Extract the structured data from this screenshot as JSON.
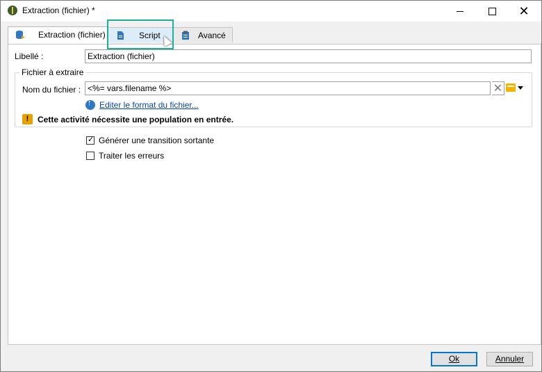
{
  "window": {
    "title": "Extraction (fichier) *"
  },
  "tabs": [
    {
      "label": "Extraction (fichier)",
      "icon": "database-export-icon"
    },
    {
      "label": "Script",
      "icon": "script-file-icon"
    },
    {
      "label": "Avancé",
      "icon": "clipboard-icon"
    }
  ],
  "form": {
    "libelle_label": "Libellé :",
    "libelle_value": "Extraction (fichier)",
    "group_title": "Fichier à extraire",
    "nom_label": "Nom du fichier :",
    "nom_value": "<%= vars.filename %>",
    "edit_link": "Editer le format du fichier...",
    "warning": "Cette activité nécessite une population en entrée.",
    "checkbox1": "Générer une transition sortante",
    "checkbox1_checked": true,
    "checkbox2": "Traiter les erreurs",
    "checkbox2_checked": false
  },
  "buttons": {
    "ok": "Ok",
    "cancel": "Annuler"
  },
  "colors": {
    "highlight": "#19b09a",
    "link": "#0645ad",
    "warning": "#e8a200"
  }
}
